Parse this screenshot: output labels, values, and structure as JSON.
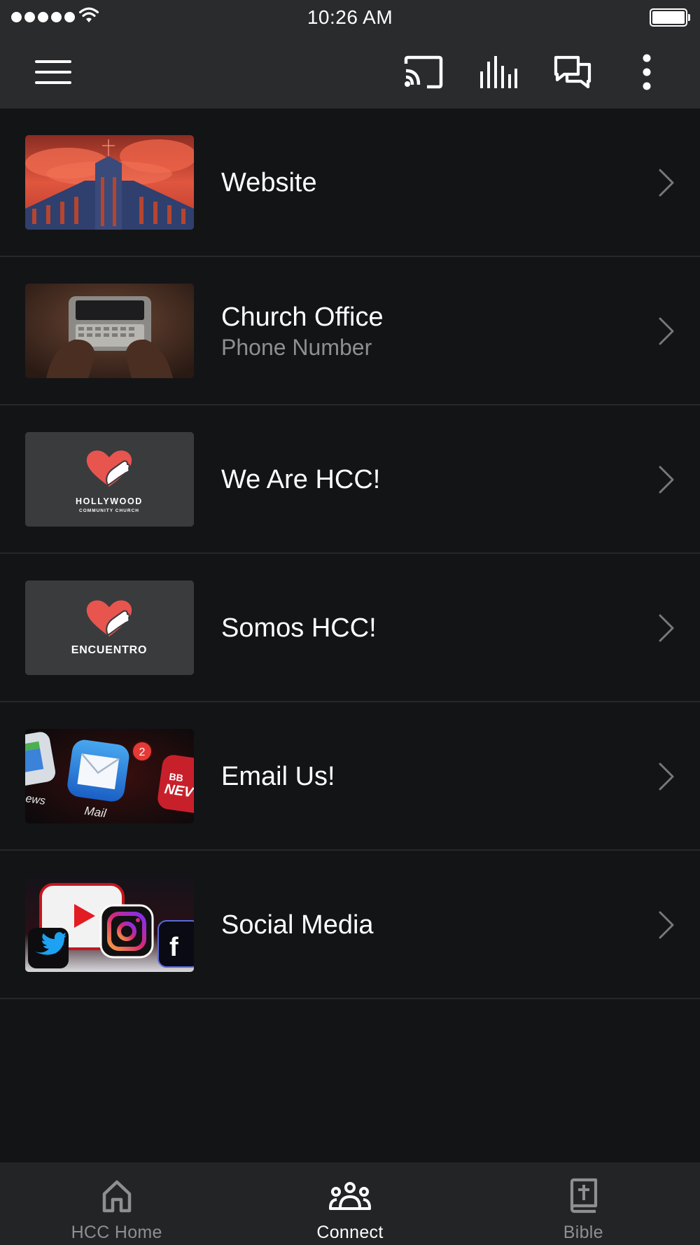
{
  "status_bar": {
    "time": "10:26 AM"
  },
  "toolbar": {
    "icons": [
      "menu-icon",
      "cast-icon",
      "stats-icon",
      "chat-icon",
      "more-vertical-icon"
    ]
  },
  "list": {
    "items": [
      {
        "title": "Website",
        "subtitle": "",
        "thumbnail": "church-building"
      },
      {
        "title": "Church Office",
        "subtitle": "Phone Number",
        "thumbnail": "hands-phone"
      },
      {
        "title": "We Are HCC!",
        "subtitle": "",
        "thumbnail": "hcc-logo",
        "thumb_text_1": "HOLLYWOOD",
        "thumb_text_2": "COMMUNITY CHURCH"
      },
      {
        "title": "Somos HCC!",
        "subtitle": "",
        "thumbnail": "encuentro-logo",
        "thumb_text_1": "ENCUENTRO"
      },
      {
        "title": "Email Us!",
        "subtitle": "",
        "thumbnail": "mail-apps",
        "thumb_text_1": "Mail",
        "thumb_text_2": "ews",
        "thumb_text_3": "2",
        "thumb_text_4": "BB",
        "thumb_text_5": "NEV"
      },
      {
        "title": "Social Media",
        "subtitle": "",
        "thumbnail": "social-apps",
        "thumb_text_1": "f"
      }
    ]
  },
  "tab_bar": {
    "tabs": [
      {
        "label": "HCC Home",
        "icon": "home-icon",
        "active": false
      },
      {
        "label": "Connect",
        "icon": "people-icon",
        "active": true
      },
      {
        "label": "Bible",
        "icon": "bible-icon",
        "active": false
      }
    ]
  },
  "colors": {
    "background": "#131416",
    "bar": "#2a2b2d",
    "divider": "#26282b",
    "secondary_text": "#8e8f93",
    "heart": "#e8544e"
  }
}
